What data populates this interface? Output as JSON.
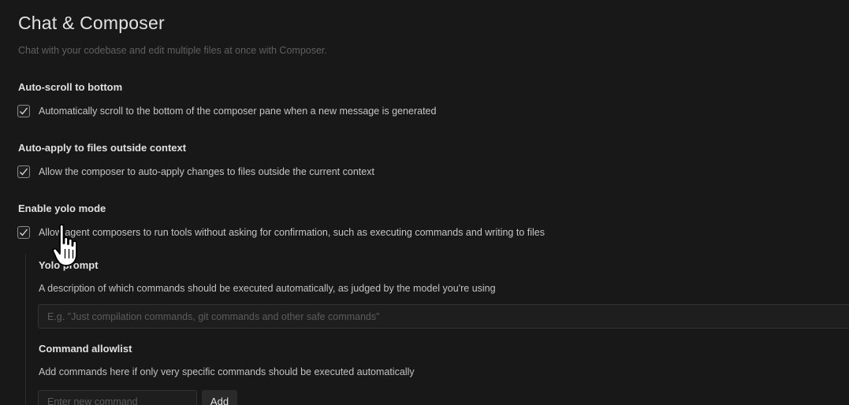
{
  "header": {
    "title": "Chat & Composer",
    "subtitle": "Chat with your codebase and edit multiple files at once with Composer."
  },
  "settings": {
    "auto_scroll": {
      "label": "Auto-scroll to bottom",
      "description": "Automatically scroll to the bottom of the composer pane when a new message is generated",
      "checked": true
    },
    "auto_apply": {
      "label": "Auto-apply to files outside context",
      "description": "Allow the composer to auto-apply changes to files outside the current context",
      "checked": true
    },
    "yolo_mode": {
      "label": "Enable yolo mode",
      "description": "Allow agent composers to run tools without asking for confirmation, such as executing commands and writing to files",
      "checked": true
    }
  },
  "yolo_prompt": {
    "label": "Yolo prompt",
    "description": "A description of which commands should be executed automatically, as judged by the model you're using",
    "placeholder": "E.g. \"Just compilation commands, git commands and other safe commands\"",
    "value": ""
  },
  "command_allowlist": {
    "label": "Command allowlist",
    "description": "Add commands here if only very specific commands should be executed automatically",
    "placeholder": "Enter new command",
    "value": "",
    "add_label": "Add"
  },
  "icons": {
    "checkbox_check": "check-icon",
    "cursor": "hand-pointer-icon"
  },
  "colors": {
    "background": "#181818",
    "text_primary": "#e0e0e0",
    "text_muted": "#5f5f5f"
  }
}
